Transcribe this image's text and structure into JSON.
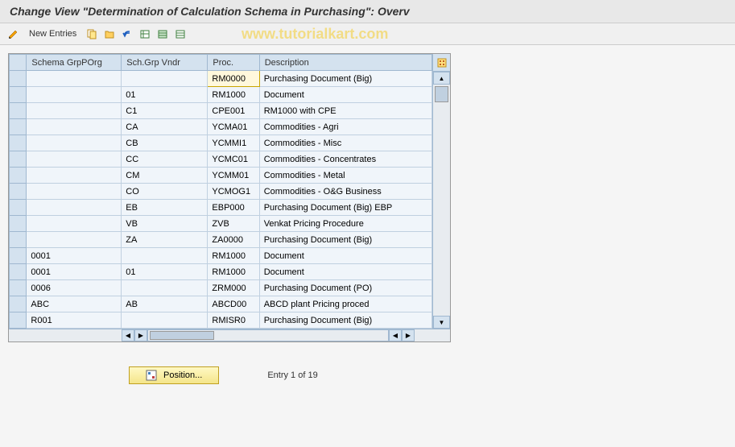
{
  "title": "Change View \"Determination of Calculation Schema in Purchasing\": Overv",
  "watermark": "www.tutorialkart.com",
  "toolbar": {
    "new_entries": "New Entries"
  },
  "table": {
    "headers": {
      "grporg": "Schema GrpPOrg",
      "grpvndr": "Sch.Grp Vndr",
      "proc": "Proc.",
      "desc": "Description"
    },
    "rows": [
      {
        "grporg": "",
        "grpvndr": "",
        "proc": "RM0000",
        "desc": "Purchasing Document (Big)",
        "highlight": true
      },
      {
        "grporg": "",
        "grpvndr": "01",
        "proc": "RM1000",
        "desc": "Document"
      },
      {
        "grporg": "",
        "grpvndr": "C1",
        "proc": "CPE001",
        "desc": "RM1000 with CPE"
      },
      {
        "grporg": "",
        "grpvndr": "CA",
        "proc": "YCMA01",
        "desc": "Commodities - Agri"
      },
      {
        "grporg": "",
        "grpvndr": "CB",
        "proc": "YCMMI1",
        "desc": "Commodities - Misc"
      },
      {
        "grporg": "",
        "grpvndr": "CC",
        "proc": "YCMC01",
        "desc": "Commodities - Concentrates"
      },
      {
        "grporg": "",
        "grpvndr": "CM",
        "proc": "YCMM01",
        "desc": "Commodities - Metal"
      },
      {
        "grporg": "",
        "grpvndr": "CO",
        "proc": "YCMOG1",
        "desc": "Commodities - O&G Business"
      },
      {
        "grporg": "",
        "grpvndr": "EB",
        "proc": "EBP000",
        "desc": "Purchasing Document (Big) EBP"
      },
      {
        "grporg": "",
        "grpvndr": "VB",
        "proc": "ZVB",
        "desc": "Venkat Pricing Procedure"
      },
      {
        "grporg": "",
        "grpvndr": "ZA",
        "proc": "ZA0000",
        "desc": "Purchasing Document (Big)"
      },
      {
        "grporg": "0001",
        "grpvndr": "",
        "proc": "RM1000",
        "desc": "Document"
      },
      {
        "grporg": "0001",
        "grpvndr": "01",
        "proc": "RM1000",
        "desc": "Document"
      },
      {
        "grporg": "0006",
        "grpvndr": "",
        "proc": "ZRM000",
        "desc": "Purchasing Document (PO)"
      },
      {
        "grporg": "ABC",
        "grpvndr": "AB",
        "proc": "ABCD00",
        "desc": "ABCD plant Pricing proced"
      },
      {
        "grporg": "R001",
        "grpvndr": "",
        "proc": "RMISR0",
        "desc": "Purchasing Document (Big)"
      }
    ]
  },
  "position_label": "Position...",
  "entry_text": "Entry 1 of 19"
}
